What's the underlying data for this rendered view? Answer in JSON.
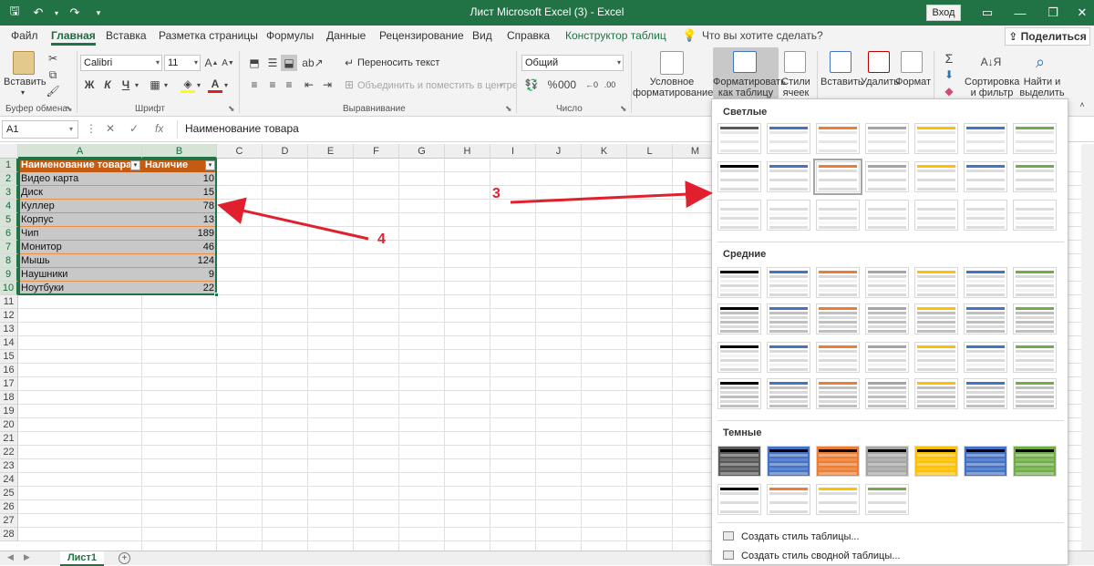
{
  "window": {
    "title": "Лист Microsoft Excel (3)  -  Excel",
    "login_label": "Вход",
    "accent": "#217346"
  },
  "tabs": [
    {
      "label": "Файл"
    },
    {
      "label": "Главная"
    },
    {
      "label": "Вставка"
    },
    {
      "label": "Разметка страницы"
    },
    {
      "label": "Формулы"
    },
    {
      "label": "Данные"
    },
    {
      "label": "Рецензирование"
    },
    {
      "label": "Вид"
    },
    {
      "label": "Справка"
    },
    {
      "label": "Конструктор таблиц"
    }
  ],
  "active_tab": "Главная",
  "search_placeholder": "Что вы хотите сделать?",
  "share_label": "Поделиться",
  "ribbon": {
    "clipboard": {
      "paste_label": "Вставить",
      "group": "Буфер обмена"
    },
    "font": {
      "name": "Calibri",
      "size": "11",
      "group": "Шрифт",
      "bold": "Ж",
      "italic": "К",
      "underline": "Ч"
    },
    "alignment": {
      "wrap_text": "Переносить текст",
      "merge_center": "Объединить и поместить в центре",
      "group": "Выравнивание"
    },
    "number": {
      "format": "Общий",
      "group": "Число"
    },
    "styles": {
      "conditional": "Условное форматирование",
      "format_table": "Форматировать как таблицу",
      "cell_styles": "Стили ячеек"
    },
    "cells": {
      "insert": "Вставить",
      "delete": "Удалить",
      "format": "Формат"
    },
    "editing": {
      "sort_filter": "Сортировка и фильтр",
      "find_select": "Найти и выделить"
    }
  },
  "formula_bar": {
    "name_box": "A1",
    "formula": "Наименование товара"
  },
  "grid": {
    "columns": [
      "A",
      "B",
      "C",
      "D",
      "E",
      "F",
      "G",
      "H",
      "I",
      "J",
      "K",
      "L",
      "M"
    ],
    "rows": [
      "1",
      "2",
      "3",
      "4",
      "5",
      "6",
      "7",
      "8",
      "9",
      "10",
      "11",
      "12",
      "13",
      "14",
      "15",
      "16",
      "17",
      "18",
      "19",
      "20",
      "21",
      "22",
      "23",
      "24",
      "25",
      "26",
      "27",
      "28"
    ],
    "table_headers": [
      "Наименование товара",
      "Наличие"
    ],
    "table_rows": [
      [
        "Видео карта",
        "10"
      ],
      [
        "Диск",
        "15"
      ],
      [
        "Куллер",
        "78"
      ],
      [
        "Корпус",
        "13"
      ],
      [
        "Чип",
        "189"
      ],
      [
        "Монитор",
        "46"
      ],
      [
        "Мышь",
        "124"
      ],
      [
        "Наушники",
        "9"
      ],
      [
        "Ноутбуки",
        "22"
      ]
    ],
    "header_color": "#c55a11",
    "row_color": "#c8c8c8"
  },
  "sheet": {
    "tab": "Лист1"
  },
  "gallery": {
    "light": "Светлые",
    "medium": "Средние",
    "dark": "Темные",
    "new_table_style": "Создать стиль таблицы...",
    "new_pivot_style": "Создать стиль сводной таблицы...",
    "palette": [
      "#595959",
      "#4472c4",
      "#ed7d31",
      "#a5a5a5",
      "#ffc000",
      "#4472c4",
      "#70ad47"
    ]
  },
  "annotations": {
    "label_3": "3",
    "label_4": "4",
    "color": "#e0202e"
  }
}
